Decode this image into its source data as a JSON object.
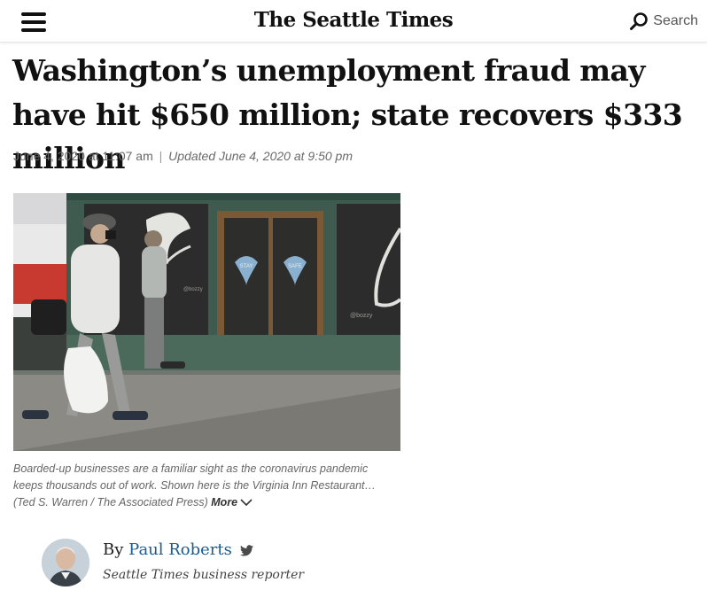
{
  "header": {
    "logo": "The Seattle Times",
    "search_label": "Search",
    "menu_icon": "hamburger-menu-icon",
    "search_icon": "search-icon"
  },
  "article": {
    "headline": "Washington’s unemployment fraud may have hit $650 million; state recovers $333 million",
    "published": "June 4, 2020 at 11:07 am",
    "separator": "|",
    "updated": "Updated June 4, 2020 at 9:50 pm"
  },
  "photo": {
    "door_left_text": "STAY",
    "door_right_text": "SAFE",
    "tag_left": "@bozzy",
    "tag_right": "@bozzy",
    "caption": "Boarded-up businesses are a familiar sight as the coronavirus pandemic keeps thousands out of work. Shown here is the Virginia Inn Restaurant… (Ted S. Warren / The Associated Press)",
    "more_label": "More"
  },
  "byline": {
    "by": "By",
    "author": "Paul Roberts",
    "role": "Seattle Times business reporter",
    "twitter_icon": "twitter-icon"
  },
  "colors": {
    "author_link": "#1b5c91",
    "meta_gray": "#6a6a6a"
  }
}
